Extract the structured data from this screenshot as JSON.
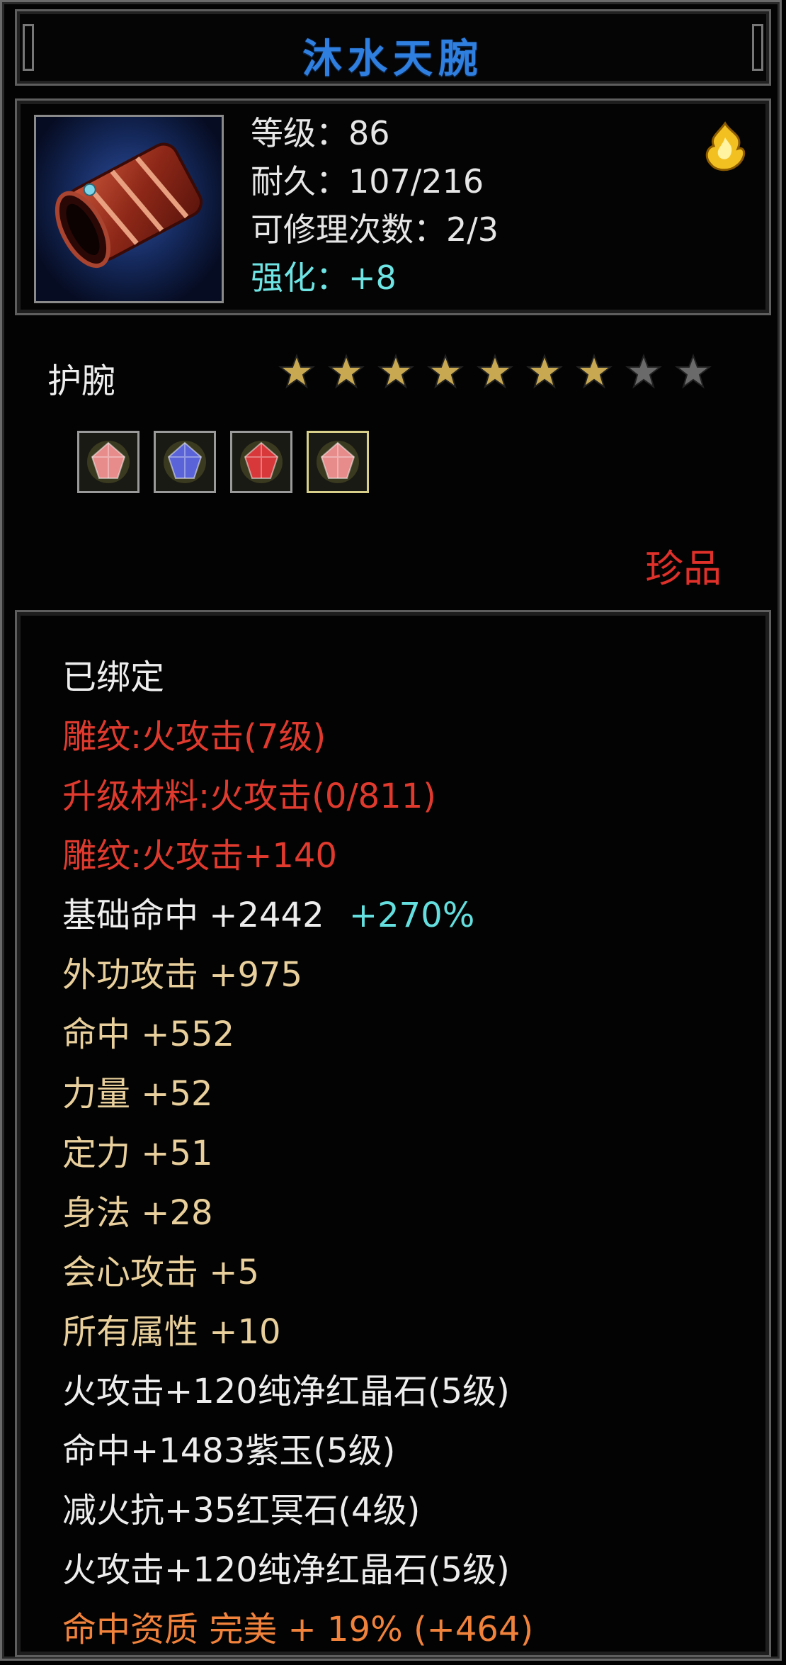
{
  "item": {
    "name": "沐水天腕",
    "level_text": "等级：86",
    "durability_text": "耐久：107/216",
    "repair_text": "可修理次数：2/3",
    "enhance_text": "强化：+8",
    "type": "护腕",
    "stars_filled": 7,
    "stars_total": 9,
    "rarity": "珍品",
    "icon": "bracer-icon",
    "badge_icon": "gold-flame-badge-icon"
  },
  "gems": [
    {
      "name": "pink-crystal-gem-icon",
      "color": "#e78b8b",
      "selected": false
    },
    {
      "name": "purple-jade-gem-icon",
      "color": "#5a64d8",
      "selected": false
    },
    {
      "name": "red-crystal-gem-icon",
      "color": "#d8383a",
      "selected": false
    },
    {
      "name": "pink-crystal-gem-icon",
      "color": "#e78b8b",
      "selected": true
    }
  ],
  "details": {
    "bound": "已绑定",
    "engrave1": "雕纹:火攻击(7级)",
    "upgrade": "升级材料:火攻击(0/811)",
    "engrave2": "雕纹:火攻击+140",
    "base_hit_label": "基础命中 +2442",
    "base_hit_bonus": "+270%",
    "ext_attack": "外功攻击 +975",
    "hit": "命中 +552",
    "strength": "力量 +52",
    "focus": "定力 +51",
    "agility": "身法 +28",
    "crit": "会心攻击 +5",
    "all_attr": "所有属性 +10",
    "gem1": "火攻击+120纯净红晶石(5级)",
    "gem2": "命中+1483紫玉(5级)",
    "gem3": "减火抗+35红冥石(4级)",
    "gem4": "火攻击+120纯净红晶石(5级)",
    "aptitude": "命中资质 完美 + 19% (+464)"
  },
  "colors": {
    "title": "#2f7fe0",
    "star_gold": "#c8a850",
    "star_gray": "#6a6a6a",
    "red": "#e03a2e",
    "tan": "#e8cf9c",
    "orange": "#f0823c",
    "cyan": "#64dede"
  }
}
